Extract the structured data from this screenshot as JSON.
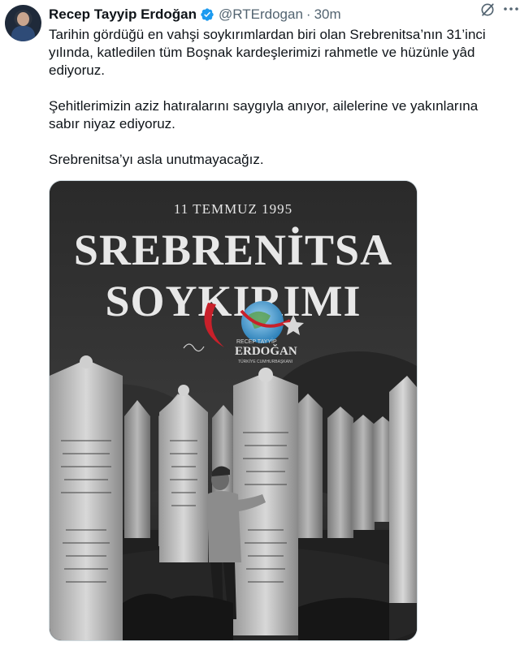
{
  "tweet": {
    "author_name": "Recep Tayyip Erdoğan",
    "handle": "@RTErdogan",
    "separator": "·",
    "time": "30m",
    "paragraphs": [
      "Tarihin gördüğü en vahşi soykırımlardan biri olan Srebrenitsa’nın 31’inci yılında, katledilen tüm Boşnak kardeşlerimizi rahmetle ve hüzünle yâd ediyoruz.",
      "Şehitlerimizin aziz hatıralarını saygıyla anıyor, ailelerine ve yakınlarına sabır niyaz ediyoruz.",
      "Srebrenitsa’yı asla unutmayacağız."
    ],
    "icons": {
      "verified": "verified-badge-icon",
      "grok": "grok-icon",
      "more": "more-icon"
    },
    "colors": {
      "verified": "#1d9bf0",
      "secondary_text": "#536471"
    }
  },
  "poster": {
    "date": "11 TEMMUZ 1995",
    "title_line1": "SREBRENİTSA",
    "title_line2": "SOYKIRIMI",
    "logo_line1": "RECEP TAYYİP",
    "logo_line2": "ERDOĞAN",
    "logo_line3": "TÜRKİYE CUMHURBAŞKANI"
  }
}
